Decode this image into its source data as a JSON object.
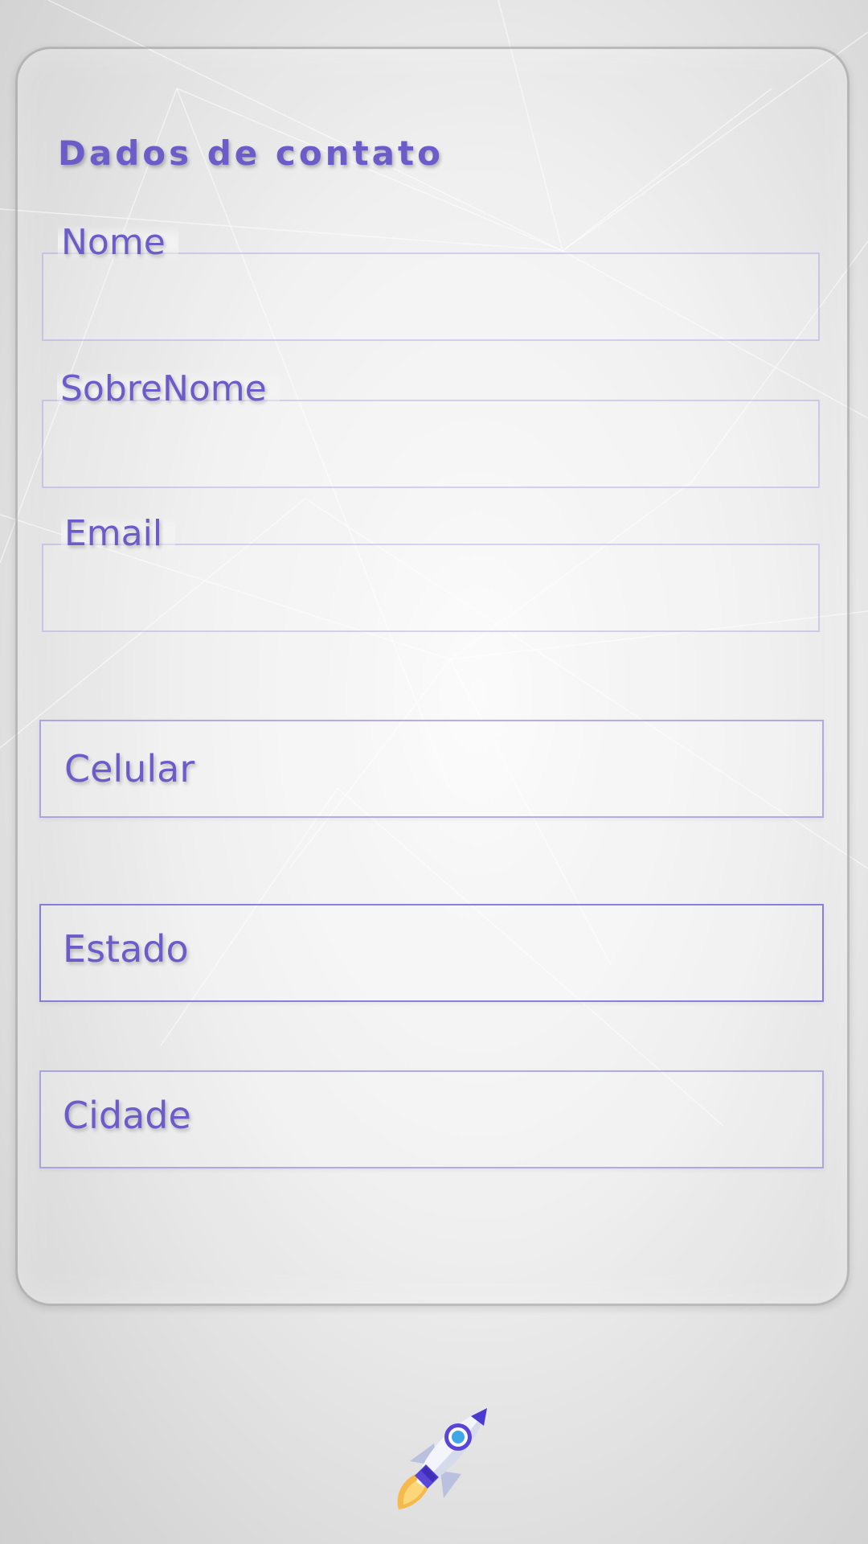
{
  "card": {
    "title": "Dados de contato"
  },
  "fields": {
    "nome": {
      "label": "Nome",
      "value": ""
    },
    "sobrenome": {
      "label": "SobreNome",
      "value": ""
    },
    "email": {
      "label": "Email",
      "value": ""
    },
    "celular": {
      "label": "Celular",
      "value": ""
    },
    "estado": {
      "label": "Estado",
      "value": ""
    },
    "cidade": {
      "label": "Cidade",
      "value": ""
    }
  },
  "submit": {
    "icon": "rocket-icon"
  },
  "colors": {
    "accent": "#6b5cc9",
    "border": "#8a80e0"
  }
}
